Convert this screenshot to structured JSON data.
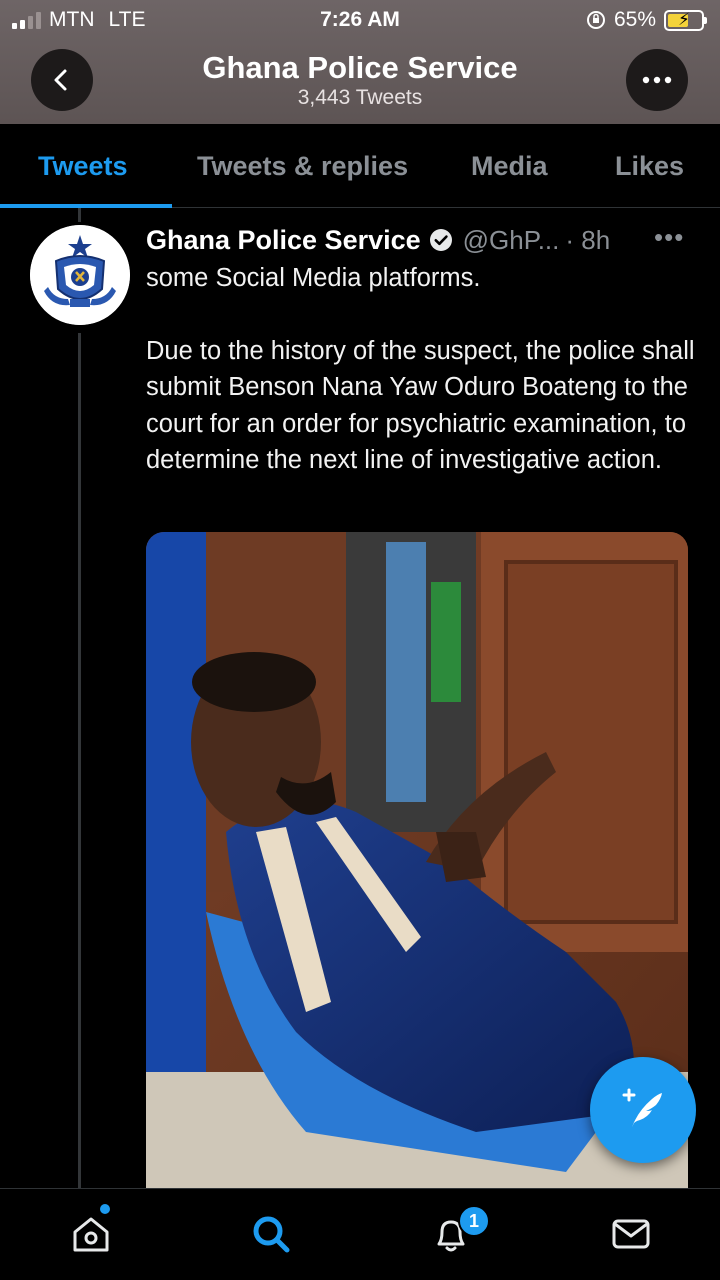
{
  "status_bar": {
    "carrier": "MTN",
    "network": "LTE",
    "time": "7:26 AM",
    "battery": "65%",
    "battery_level": 0.65
  },
  "header": {
    "title": "Ghana Police Service",
    "subtitle": "3,443 Tweets",
    "back_icon": "chevron-left-icon",
    "more_icon": "more-horizontal-icon"
  },
  "tabs": [
    {
      "label": "Tweets",
      "active": true
    },
    {
      "label": "Tweets & replies",
      "active": false
    },
    {
      "label": "Media",
      "active": false
    },
    {
      "label": "Likes",
      "active": false
    }
  ],
  "tweet": {
    "name": "Ghana Police Service",
    "handle": "@GhP...",
    "time": "· 8h",
    "more": "•••",
    "paragraphs": [
      "some Social Media platforms.",
      "Due to the history of the suspect, the police shall submit Benson Nana Yaw Oduro Boateng to the court for an order for psychiatric examination, to determine the next line of investigative action."
    ],
    "image_icon": "photo-icon"
  },
  "bottom_nav": {
    "items": [
      "home-icon",
      "search-icon",
      "notifications-icon",
      "messages-icon"
    ],
    "notification_count": "1"
  },
  "colors": {
    "accent": "#1d9bf0",
    "header_bg": "#655c5c",
    "muted": "#8b9096"
  }
}
